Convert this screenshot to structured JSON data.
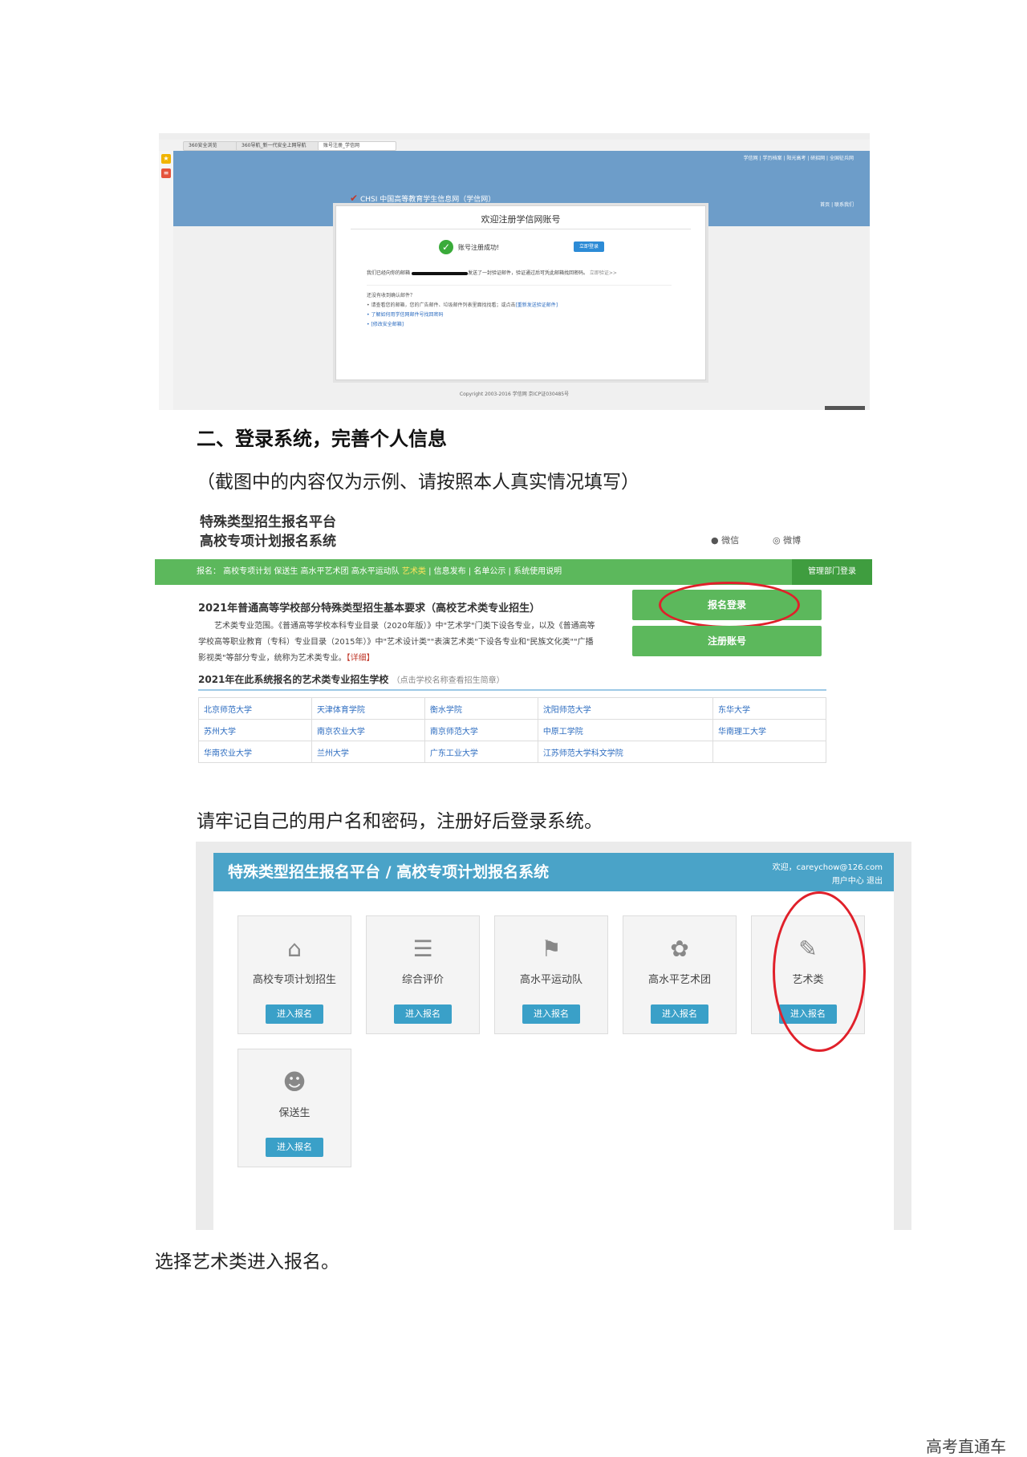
{
  "browser": {
    "tabs": [
      "360安全浏览",
      "360导航_新一代安全上网导航",
      "账号注册_学信网"
    ],
    "rail_icons": [
      "star-icon",
      "news-icon"
    ],
    "top_links": "学信网  |  学历档案  |  阳光高考  |  研招网  |  全国征兵网",
    "site_logo": "CHSI 中国高等教育学生信息网（学信网）",
    "head_links": "首页  |  联系我们",
    "register_title": "欢迎注册学信网账号",
    "success_text": "账号注册成功!",
    "login_now": "立即登录",
    "mail_prefix": "我们已经向你的邮箱",
    "mail_suffix": "发送了一封验证邮件，验证通过后可凭此邮箱找回密码。",
    "mail_link": "立即验证>>",
    "tips_title": "还没有收到确认邮件？",
    "tip1": "• 请查看您的邮箱，您的广告邮件、垃圾邮件列表里面找找看；或点击",
    "tip1_link": "[重新发送验证邮件]",
    "tip2": "• 了解如何用学信网邮件号找回密码",
    "tip3": "• [修改安全邮箱]",
    "copyright": "Copyright 2003-2016    学信网    京ICP证030485号"
  },
  "section": {
    "heading": "二、登录系统，完善个人信息",
    "note": "（截图中的内容仅为示例、请按照本人真实情况填写）",
    "remember": "请牢记自己的用户名和密码，注册好后登录系统。",
    "choose": "选择艺术类进入报名。"
  },
  "platform": {
    "title_line1": "特殊类型招生报名平台",
    "title_line2": "高校专项计划报名系统",
    "wechat": "微信",
    "weibo": "微博",
    "nav_prefix": "报名：  高校专项计划  保送生  高水平艺术团  高水平运动队  ",
    "nav_art": "艺术类",
    "nav_rest": "   |   信息发布   |   名单公示   |   系统使用说明",
    "manager_login": "管理部门登录",
    "req_title": "2021年普通高等学校部分特殊类型招生基本要求（高校艺术类专业招生）",
    "req_body": "艺术类专业范围。《普通高等学校本科专业目录（2020年版）》中\"艺术学\"门类下设各专业，以及《普通高等学校高等职业教育（专科）专业目录（2015年）》中\"艺术设计类\"\"表演艺术类\"下设各专业和\"民族文化类\"\"广播影视类\"等部分专业，统称为艺术类专业。",
    "detail": "【详细】",
    "register_login": "报名登录",
    "register_account": "注册账号",
    "schools_title": "2021年在此系统报名的艺术类专业招生学校",
    "schools_hint": "（点击学校名称查看招生简章）",
    "schools": [
      [
        "北京师范大学",
        "天津体育学院",
        "衡水学院",
        "沈阳师范大学",
        "东华大学"
      ],
      [
        "苏州大学",
        "南京农业大学",
        "南京师范大学",
        "中原工学院",
        "华南理工大学"
      ],
      [
        "华南农业大学",
        "兰州大学",
        "广东工业大学",
        "江苏师范大学科文学院",
        ""
      ]
    ]
  },
  "app": {
    "title": "特殊类型招生报名平台 / 高校专项计划报名系统",
    "welcome": "欢迎，careychow@126.com",
    "user_links": "用户中心   退出",
    "go_label": "进入报名",
    "cards": [
      {
        "label": "高校专项计划招生",
        "icon": "tree-house-icon"
      },
      {
        "label": "综合评价",
        "icon": "checklist-icon"
      },
      {
        "label": "高水平运动队",
        "icon": "runner-icon"
      },
      {
        "label": "高水平艺术团",
        "icon": "palette-icon"
      },
      {
        "label": "艺术类",
        "icon": "palette-brush-icon"
      },
      {
        "label": "保送生",
        "icon": "users-icon"
      }
    ]
  },
  "footer": {
    "brand": "高考直通车"
  },
  "colors": {
    "chsi_blue": "#6d9dc9",
    "green": "#5cb85c",
    "app_blue": "#4aa3c8",
    "red_mark": "#e0202a"
  }
}
